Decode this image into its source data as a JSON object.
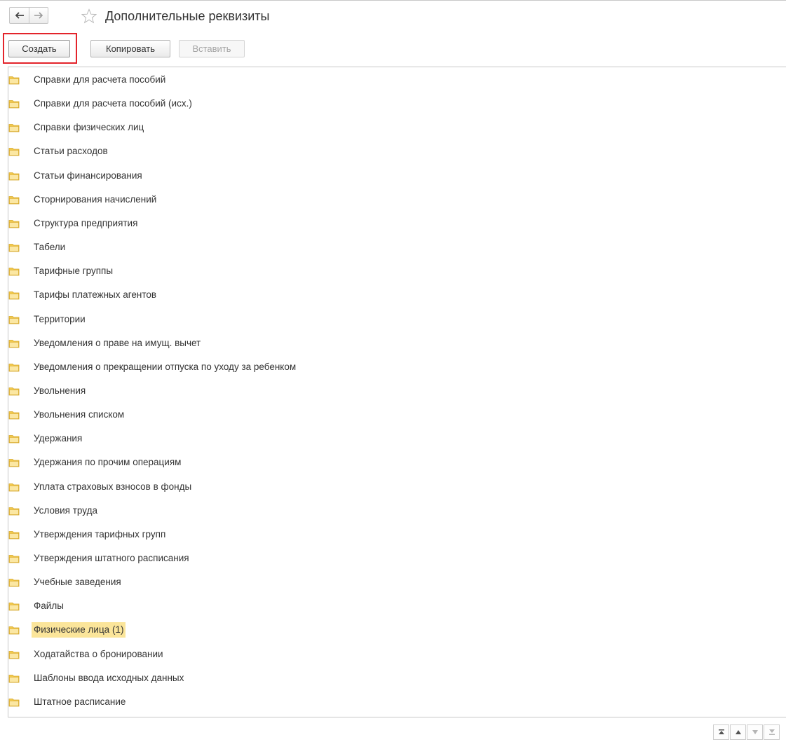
{
  "header": {
    "title": "Дополнительные реквизиты",
    "nav_icons": [
      "arrow-left-icon",
      "arrow-right-icon",
      "star-icon"
    ]
  },
  "toolbar": {
    "create_label": "Создать",
    "copy_label": "Копировать",
    "paste_label": "Вставить",
    "highlight_color": "#e3242b"
  },
  "list": {
    "items": [
      "Справки для расчета пособий",
      "Справки для расчета пособий (исх.)",
      "Справки физических лиц",
      "Статьи расходов",
      "Статьи финансирования",
      "Сторнирования начислений",
      "Структура предприятия",
      "Табели",
      "Тарифные группы",
      "Тарифы платежных агентов",
      "Территории",
      "Уведомления о праве на имущ. вычет",
      "Уведомления о прекращении отпуска по уходу за ребенком",
      "Увольнения",
      "Увольнения списком",
      "Удержания",
      "Удержания по прочим операциям",
      "Уплата страховых взносов в фонды",
      "Условия труда",
      "Утверждения тарифных групп",
      "Утверждения штатного расписания",
      "Учебные заведения",
      "Файлы",
      "Физические лица (1)",
      "Ходатайства о бронировании",
      "Шаблоны ввода исходных данных",
      "Штатное расписание"
    ],
    "selected_index": 23,
    "item_icon": "folder-icon",
    "folder_color": "#f2c94c",
    "selection_color": "#fbe59a"
  },
  "scroll": {
    "icons": [
      "scroll-first-icon",
      "scroll-up-icon",
      "scroll-down-icon",
      "scroll-last-icon"
    ]
  }
}
